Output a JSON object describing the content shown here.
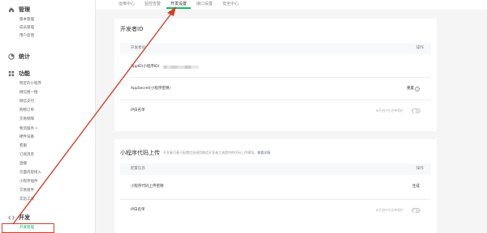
{
  "sidebar": {
    "groups": [
      {
        "title": "管理",
        "icon": "home-icon",
        "items": [
          "版本管理",
          "成员管理",
          "用户反馈"
        ]
      },
      {
        "title": "统计",
        "icon": "stats-icon",
        "items": []
      },
      {
        "title": "功能",
        "icon": "function-icon",
        "items": [
          "附近的小程序",
          "微信搜一搜",
          "微信支付",
          "购物订单",
          "交易保障",
          "物流服务",
          "硬件设备",
          "客服",
          "订阅消息",
          "直播",
          "页面内容接入",
          "小程序插件",
          "交易组件",
          "实验工具"
        ]
      },
      {
        "title": "开发",
        "icon": "code-icon",
        "items": [
          "开发管理"
        ]
      }
    ],
    "badge_mark": "•"
  },
  "tabs": {
    "items": [
      "运维中心",
      "监控告警",
      "开发设置",
      "接口设置",
      "安全中心"
    ],
    "active_index": 2
  },
  "developer_id": {
    "title": "开发者ID",
    "col_left": "开发者ID",
    "col_right": "操作",
    "rows": [
      {
        "label": "AppID(小程序ID)",
        "masked": true
      },
      {
        "label": "AppSecret(小程序密钥)",
        "action": "重置"
      },
      {
        "label": "IP白名单",
        "switch_label": "未开启IP白名单保护",
        "switch_on": false
      }
    ]
  },
  "code_upload": {
    "title": "小程序代码上传",
    "desc": "开发者可基于配置信息调用微信开发者工具提供的代码上传模块。",
    "desc_link": "查看详情",
    "col_left": "配置信息",
    "col_right": "操作",
    "rows": [
      {
        "label": "小程序代码上传密钥",
        "action": "生成"
      },
      {
        "label": "IP白名单",
        "switch_label": "未开启IP白名单保护",
        "switch_on": false
      }
    ]
  },
  "colors": {
    "accent": "#07c160",
    "highlight": "#d53f2b",
    "link": "#576b95"
  }
}
